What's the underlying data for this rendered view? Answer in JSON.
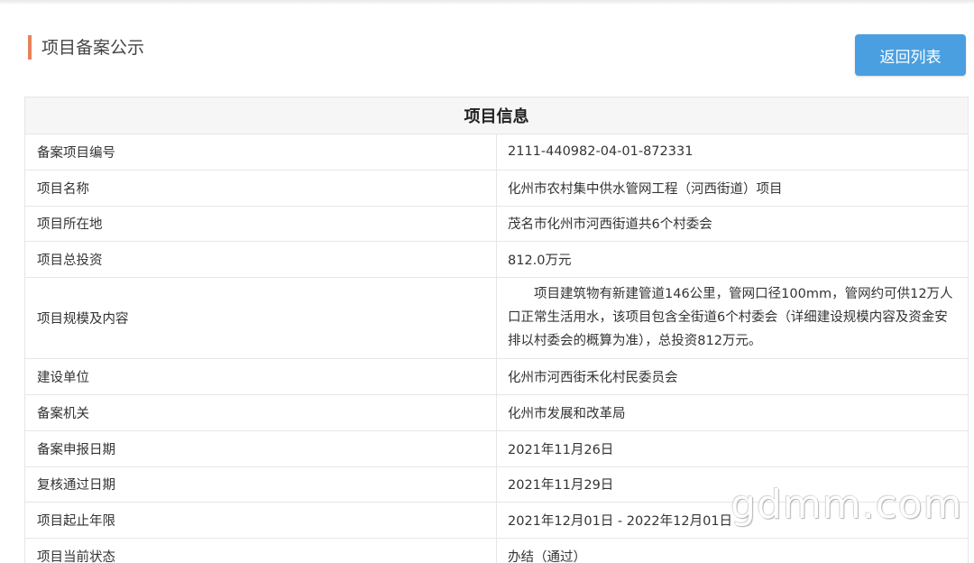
{
  "header": {
    "title": "项目备案公示",
    "back_button_label": "返回列表",
    "accent_color": "#e8825a",
    "button_color": "#4a9fe0"
  },
  "table": {
    "title": "项目信息",
    "rows": [
      {
        "label": "备案项目编号",
        "value": "2111-440982-04-01-872331"
      },
      {
        "label": "项目名称",
        "value": "化州市农村集中供水管网工程（河西街道）项目"
      },
      {
        "label": "项目所在地",
        "value": "茂名市化州市河西街道共6个村委会"
      },
      {
        "label": "项目总投资",
        "value": "812.0万元"
      },
      {
        "label": "项目规模及内容",
        "value": "项目建筑物有新建管道146公里，管网口径100mm，管网约可供12万人口正常生活用水，该项目包含全街道6个村委会（详细建设规模内容及资金安排以村委会的概算为准），总投资812万元。"
      },
      {
        "label": "建设单位",
        "value": "化州市河西街禾化村民委员会"
      },
      {
        "label": "备案机关",
        "value": "化州市发展和改革局"
      },
      {
        "label": "备案申报日期",
        "value": "2021年11月26日"
      },
      {
        "label": "复核通过日期",
        "value": "2021年11月29日"
      },
      {
        "label": "项目起止年限",
        "value": "2021年12月01日 - 2022年12月01日"
      },
      {
        "label": "项目当前状态",
        "value": "办结（通过）"
      }
    ]
  },
  "watermark": "gdmm.com"
}
